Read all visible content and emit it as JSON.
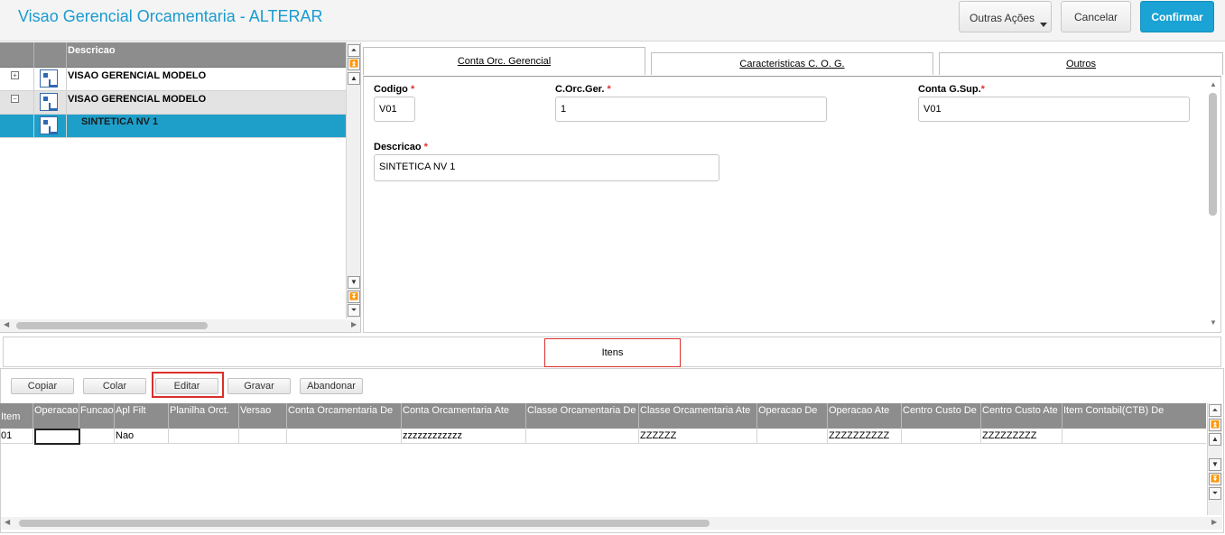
{
  "header": {
    "title": "Visao Gerencial Orcamentaria - ALTERAR",
    "outras_acoes": "Outras Ações",
    "cancelar": "Cancelar",
    "confirmar": "Confirmar"
  },
  "tree": {
    "column_header": "Descricao",
    "rows": [
      {
        "label": "VISAO GERENCIAL MODELO",
        "expander": "+"
      },
      {
        "label": "VISAO GERENCIAL MODELO",
        "expander": "−"
      },
      {
        "label": "SINTETICA NV 1",
        "selected": true
      }
    ]
  },
  "tabs": [
    "Conta Orc. Gerencial",
    "Caracteristicas C. O. G.",
    "Outros"
  ],
  "form": {
    "codigo_label": "Codigo",
    "codigo_value": "V01",
    "corcger_label": "C.Orc.Ger.",
    "corcger_value": "1",
    "contagsup_label": "Conta G.Sup.",
    "contagsup_value": "V01",
    "descricao_label": "Descricao",
    "descricao_value": "SINTETICA NV 1",
    "required_mark": "*"
  },
  "items": {
    "tab_label": "Itens",
    "buttons": {
      "copiar": "Copiar",
      "colar": "Colar",
      "editar": "Editar",
      "gravar": "Gravar",
      "abandonar": "Abandonar"
    },
    "columns": [
      "Item",
      "Operacao",
      "Funcao",
      "Apl Filt",
      "Planilha Orct.",
      "Versao",
      "Conta Orcamentaria De",
      "Conta Orcamentaria Ate",
      "Classe Orcamentaria De",
      "Classe Orcamentaria Ate",
      "Operacao De",
      "Operacao Ate",
      "Centro Custo De",
      "Centro Custo Ate",
      "Item Contabil(CTB) De"
    ],
    "row": [
      "01",
      "",
      "",
      "Nao",
      "",
      "",
      "",
      "zzzzzzzzzzzz",
      "",
      "ZZZZZZ",
      "",
      "ZZZZZZZZZZ",
      "",
      "ZZZZZZZZZ",
      ""
    ]
  },
  "icons": {
    "tree_node": "tree-node-icon",
    "scroll_up": "arrow-up-icon",
    "scroll_down": "arrow-down-icon",
    "caret": "caret-down-icon"
  },
  "colors": {
    "accent": "#1aa3d4",
    "title": "#1a9bd0",
    "selected_row": "#1e9fca",
    "highlight": "#d9302c",
    "header_grey": "#8d8d8d"
  }
}
